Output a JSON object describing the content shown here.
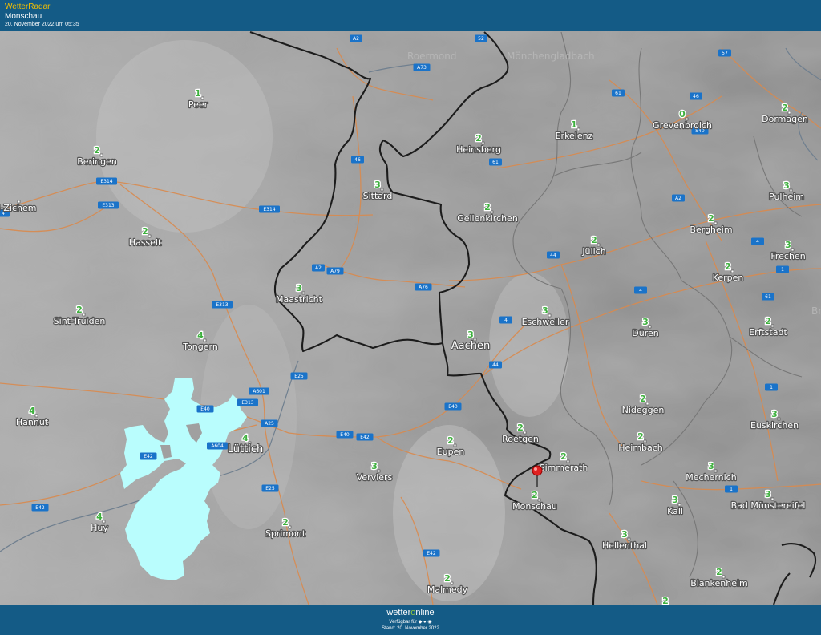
{
  "header": {
    "brand": "WetterRadar",
    "location": "Monschau",
    "timestamp": "20. November 2022 um 05:35"
  },
  "colors": {
    "header_bg": "#145b86",
    "brand_text": "#f5c000",
    "radar_precip": "#b9fdfd",
    "value_text": "#3db03d",
    "roads": "#d98a4e",
    "borders": "#222222",
    "road_label_bg": "#1a73c9",
    "marker": "#e02020"
  },
  "map": {
    "marker_location": "Monschau",
    "cities": [
      {
        "name": "Peer",
        "value": "1"
      },
      {
        "name": "Beringen",
        "value": "2"
      },
      {
        "name": "el-Zichem",
        "value": ""
      },
      {
        "name": "Hasselt",
        "value": "2"
      },
      {
        "name": "Sint-Truiden",
        "value": "2"
      },
      {
        "name": "Tongern",
        "value": "4"
      },
      {
        "name": "Hannut",
        "value": "4"
      },
      {
        "name": "Huy",
        "value": "4"
      },
      {
        "name": "Lüttich",
        "value": "4"
      },
      {
        "name": "Sprimont",
        "value": "2"
      },
      {
        "name": "Verviers",
        "value": "3"
      },
      {
        "name": "Eupen",
        "value": "2"
      },
      {
        "name": "Malmedy",
        "value": "2"
      },
      {
        "name": "Maastricht",
        "value": "3"
      },
      {
        "name": "Sittard",
        "value": "3"
      },
      {
        "name": "Heinsberg",
        "value": "2"
      },
      {
        "name": "Geilenkirchen",
        "value": "2"
      },
      {
        "name": "Aachen",
        "value": "3"
      },
      {
        "name": "Eschweiler",
        "value": "3"
      },
      {
        "name": "Jülich",
        "value": "2"
      },
      {
        "name": "Erkelenz",
        "value": "1"
      },
      {
        "name": "Grevenbroich",
        "value": "0"
      },
      {
        "name": "Dormagen",
        "value": "2"
      },
      {
        "name": "Pulheim",
        "value": "3"
      },
      {
        "name": "Bergheim",
        "value": "2"
      },
      {
        "name": "Frechen",
        "value": "3"
      },
      {
        "name": "Kerpen",
        "value": "2"
      },
      {
        "name": "Düren",
        "value": "3"
      },
      {
        "name": "Erftstadt",
        "value": "2"
      },
      {
        "name": "Nideggen",
        "value": "2"
      },
      {
        "name": "Roetgen",
        "value": "2"
      },
      {
        "name": "Simmerath",
        "value": "2"
      },
      {
        "name": "Monschau",
        "value": "2"
      },
      {
        "name": "Heimbach",
        "value": "2"
      },
      {
        "name": "Euskirchen",
        "value": "3"
      },
      {
        "name": "Mechernich",
        "value": "3"
      },
      {
        "name": "Kall",
        "value": "3"
      },
      {
        "name": "Bad Münstereifel",
        "value": "3"
      },
      {
        "name": "Hellenthal",
        "value": "3"
      },
      {
        "name": "Blankenheim",
        "value": "2"
      },
      {
        "name": "",
        "value": "2"
      }
    ],
    "road_labels": [
      "A2",
      "A73",
      "52",
      "57",
      "61",
      "46",
      "S40",
      "46",
      "A2",
      "61",
      "A2",
      "A79",
      "A76",
      "44",
      "4",
      "4",
      "1",
      "61",
      "4",
      "44",
      "E40",
      "E42",
      "E40",
      "E313",
      "A601",
      "A25",
      "E25",
      "E40",
      "A604",
      "E42",
      "E42",
      "E25",
      "E42",
      "1",
      "1",
      "E314",
      "E314",
      "E313",
      "E313",
      "4"
    ],
    "faint_labels": [
      "Roermond",
      "Mönchengladbach",
      "Bru"
    ]
  },
  "footer": {
    "logo_part1": "wetter",
    "logo_part2": "o",
    "logo_part3": "nline",
    "available": "Verfügbar für ◆ ● ◉",
    "stand": "Stand: 20. November 2022"
  }
}
